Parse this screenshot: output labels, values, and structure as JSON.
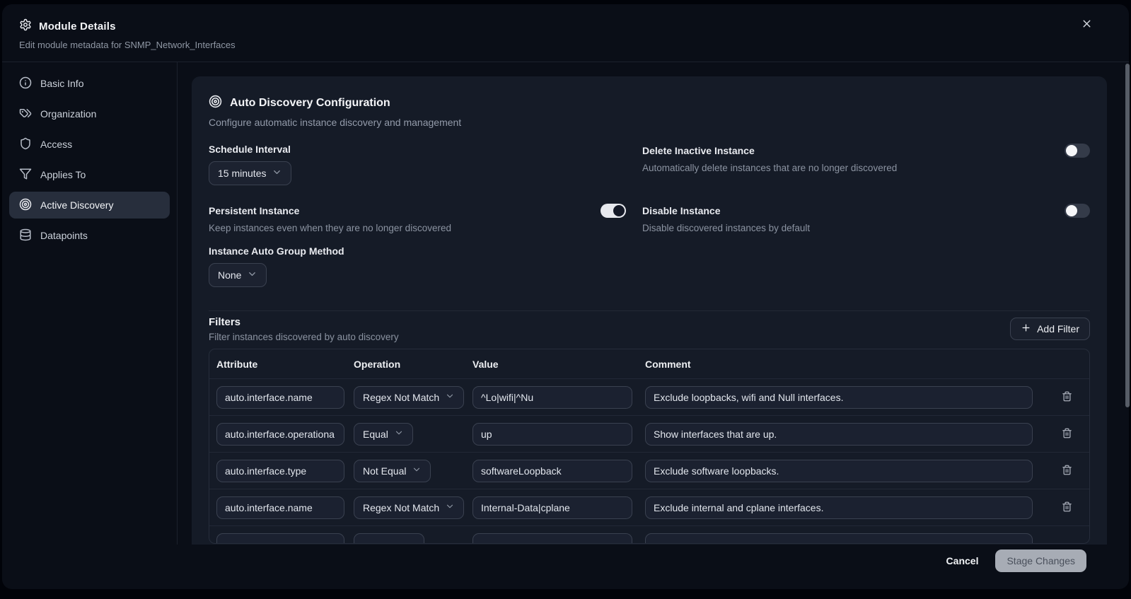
{
  "dialog": {
    "title": "Module Details",
    "subtitle": "Edit module metadata for SNMP_Network_Interfaces"
  },
  "sidebar": {
    "items": [
      {
        "label": "Basic Info",
        "icon": "info-icon",
        "active": false
      },
      {
        "label": "Organization",
        "icon": "tags-icon",
        "active": false
      },
      {
        "label": "Access",
        "icon": "shield-icon",
        "active": false
      },
      {
        "label": "Applies To",
        "icon": "funnel-icon",
        "active": false
      },
      {
        "label": "Active Discovery",
        "icon": "target-icon",
        "active": true
      },
      {
        "label": "Datapoints",
        "icon": "database-icon",
        "active": false
      }
    ]
  },
  "discovery": {
    "title": "Auto Discovery Configuration",
    "subtitle": "Configure automatic instance discovery and management",
    "schedule_interval": {
      "label": "Schedule Interval",
      "value": "15 minutes"
    },
    "delete_inactive_instance": {
      "label": "Delete Inactive Instance",
      "description": "Automatically delete instances that are no longer discovered",
      "enabled": false
    },
    "persistent_instance": {
      "label": "Persistent Instance",
      "description": "Keep instances even when they are no longer discovered",
      "enabled": true
    },
    "disable_instance": {
      "label": "Disable Instance",
      "description": "Disable discovered instances by default",
      "enabled": false
    },
    "instance_auto_group_method": {
      "label": "Instance Auto Group Method",
      "value": "None"
    }
  },
  "filters": {
    "title": "Filters",
    "subtitle": "Filter instances discovered by auto discovery",
    "add_filter_label": "Add Filter",
    "columns": {
      "attribute": "Attribute",
      "operation": "Operation",
      "value": "Value",
      "comment": "Comment"
    },
    "rows": [
      {
        "attribute": "auto.interface.name",
        "operation": "Regex Not Match",
        "value": "^Lo|wifi|^Nu",
        "comment": "Exclude loopbacks, wifi and Null interfaces."
      },
      {
        "attribute": "auto.interface.operationa",
        "operation": "Equal",
        "value": "up",
        "comment": "Show interfaces that are up."
      },
      {
        "attribute": "auto.interface.type",
        "operation": "Not Equal",
        "value": "softwareLoopback",
        "comment": "Exclude software loopbacks."
      },
      {
        "attribute": "auto.interface.name",
        "operation": "Regex Not Match",
        "value": "Internal-Data|cplane",
        "comment": "Exclude internal and cplane interfaces."
      },
      {
        "attribute": "",
        "operation": "",
        "value": "",
        "comment": ""
      }
    ]
  },
  "footer": {
    "cancel_label": "Cancel",
    "submit_label": "Stage Changes"
  },
  "colors": {
    "modal_bg": "#0a0e17",
    "card_bg": "#151b27",
    "sidebar_active_bg": "#272e3c",
    "input_border": "#3a4150",
    "toggle_on": "#e7e9ee",
    "toggle_off": "#343b49",
    "submit_bg": "#a7acb5"
  }
}
